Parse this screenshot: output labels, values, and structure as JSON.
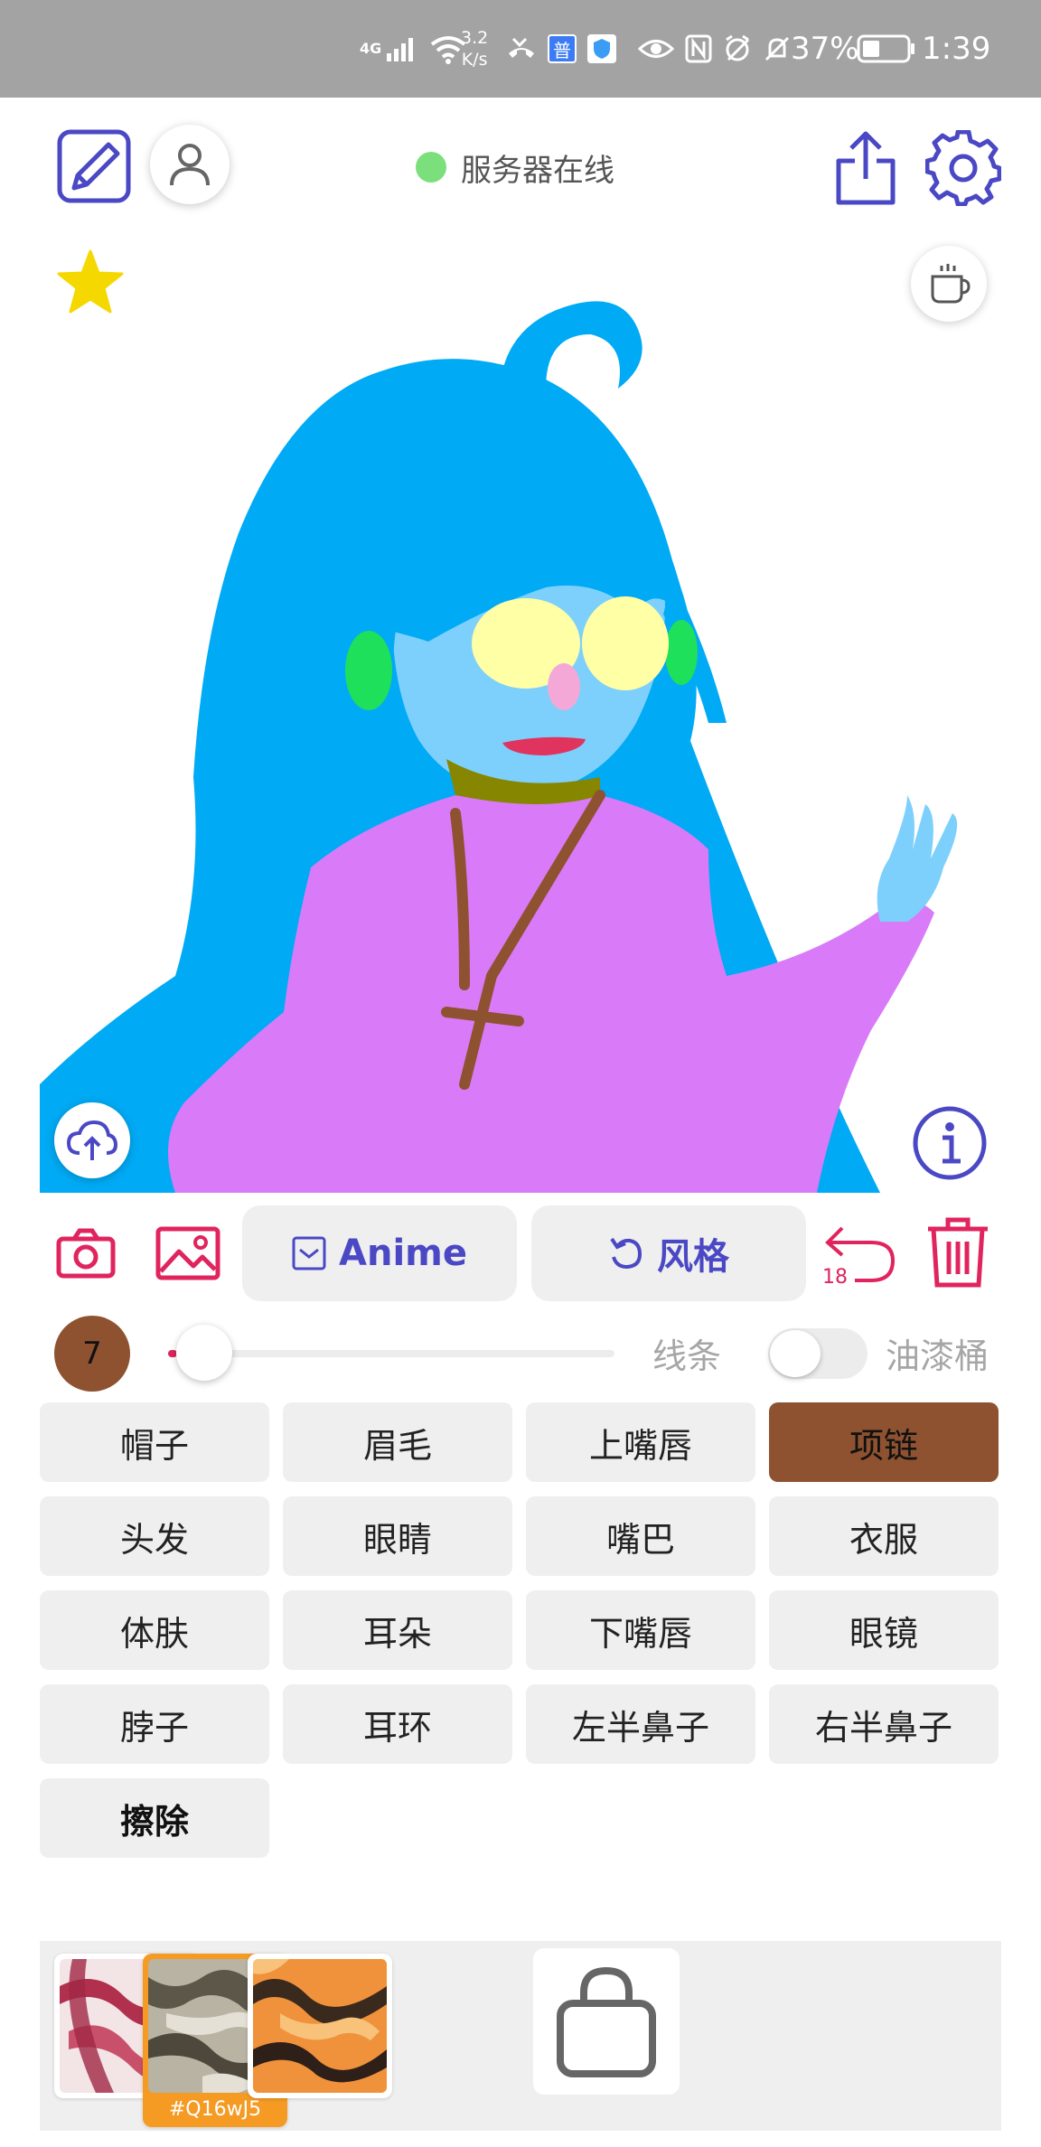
{
  "status_bar": {
    "network": "4G",
    "speed_value": "3.2",
    "speed_unit": "K/s",
    "badge_text": "普",
    "battery_text": "37%",
    "time": "1:39"
  },
  "toolbar": {
    "server_status": "服务器在线",
    "server_status_color": "#7be07b"
  },
  "actions": {
    "anime_label": "Anime",
    "style_label": "风格",
    "undo_count": "18"
  },
  "brush": {
    "size": "7",
    "color": "#8e5230",
    "size_fraction": 0.02,
    "line_label": "线条",
    "bucket_label": "油漆桶",
    "bucket_enabled": false
  },
  "parts": [
    {
      "label": "帽子"
    },
    {
      "label": "眉毛"
    },
    {
      "label": "上嘴唇"
    },
    {
      "label": "项链"
    },
    {
      "label": "头发"
    },
    {
      "label": "眼睛"
    },
    {
      "label": "嘴巴"
    },
    {
      "label": "衣服"
    },
    {
      "label": "体肤"
    },
    {
      "label": "耳朵"
    },
    {
      "label": "下嘴唇"
    },
    {
      "label": "眼镜"
    },
    {
      "label": "脖子"
    },
    {
      "label": "耳环"
    },
    {
      "label": "左半鼻子"
    },
    {
      "label": "右半鼻子"
    },
    {
      "label": "擦除"
    }
  ],
  "selected_part": "项链",
  "textures": {
    "selected_label": "#Q16wJ5"
  },
  "colors": {
    "accent": "#4a48c4",
    "danger": "#e0245e",
    "selected_texture": "#f59a23",
    "star": "#f5d800"
  }
}
